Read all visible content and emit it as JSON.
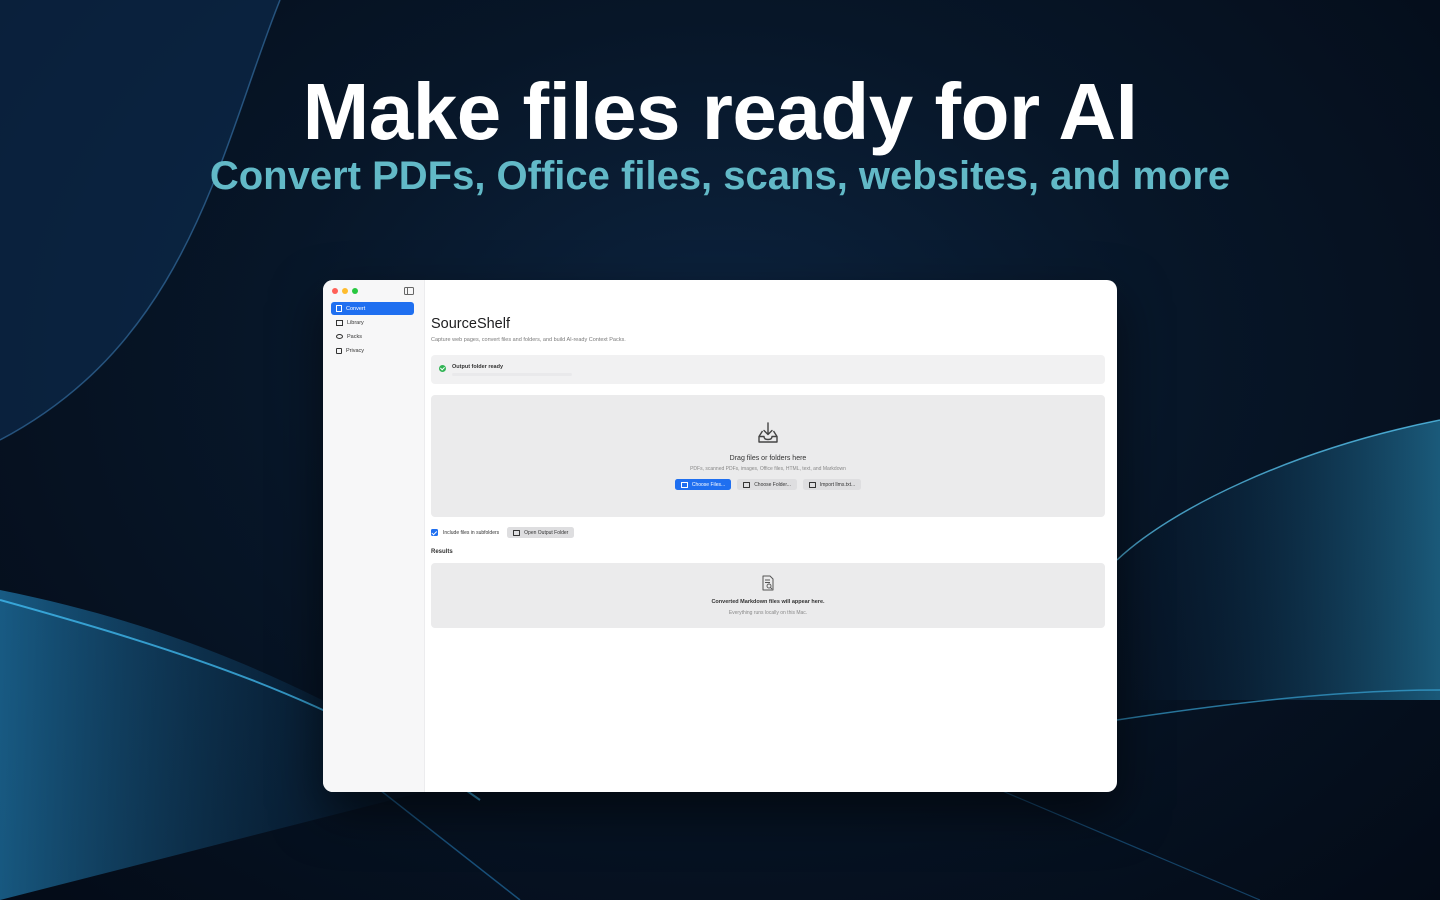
{
  "hero": {
    "headline": "Make files ready for AI",
    "subline": "Convert PDFs, Office files, scans, websites, and more"
  },
  "colors": {
    "accent": "#1f6ff0",
    "hero_subline": "#62b9c7",
    "success": "#31b455"
  },
  "sidebar": {
    "items": [
      {
        "label": "Convert",
        "icon": "document-icon",
        "active": true
      },
      {
        "label": "Library",
        "icon": "library-icon",
        "active": false
      },
      {
        "label": "Packs",
        "icon": "pack-icon",
        "active": false
      },
      {
        "label": "Privacy",
        "icon": "privacy-icon",
        "active": false
      }
    ]
  },
  "main": {
    "title": "SourceShelf",
    "subtitle": "Capture web pages, convert files and folders, and build AI-ready Context Packs.",
    "status": "Output folder ready",
    "drop_zone": {
      "title": "Drag files or folders here",
      "subtitle": "PDFs, scanned PDFs, images, Office files, HTML, text, and Markdown",
      "buttons": {
        "choose_files": "Choose Files...",
        "choose_folder": "Choose Folder...",
        "import_llms": "Import llms.txt..."
      }
    },
    "options": {
      "include_subfolders": "Include files in subfolders",
      "open_output": "Open Output Folder"
    },
    "results": {
      "label": "Results",
      "empty_title": "Converted Markdown files will appear here.",
      "empty_sub": "Everything runs locally on this Mac."
    }
  }
}
